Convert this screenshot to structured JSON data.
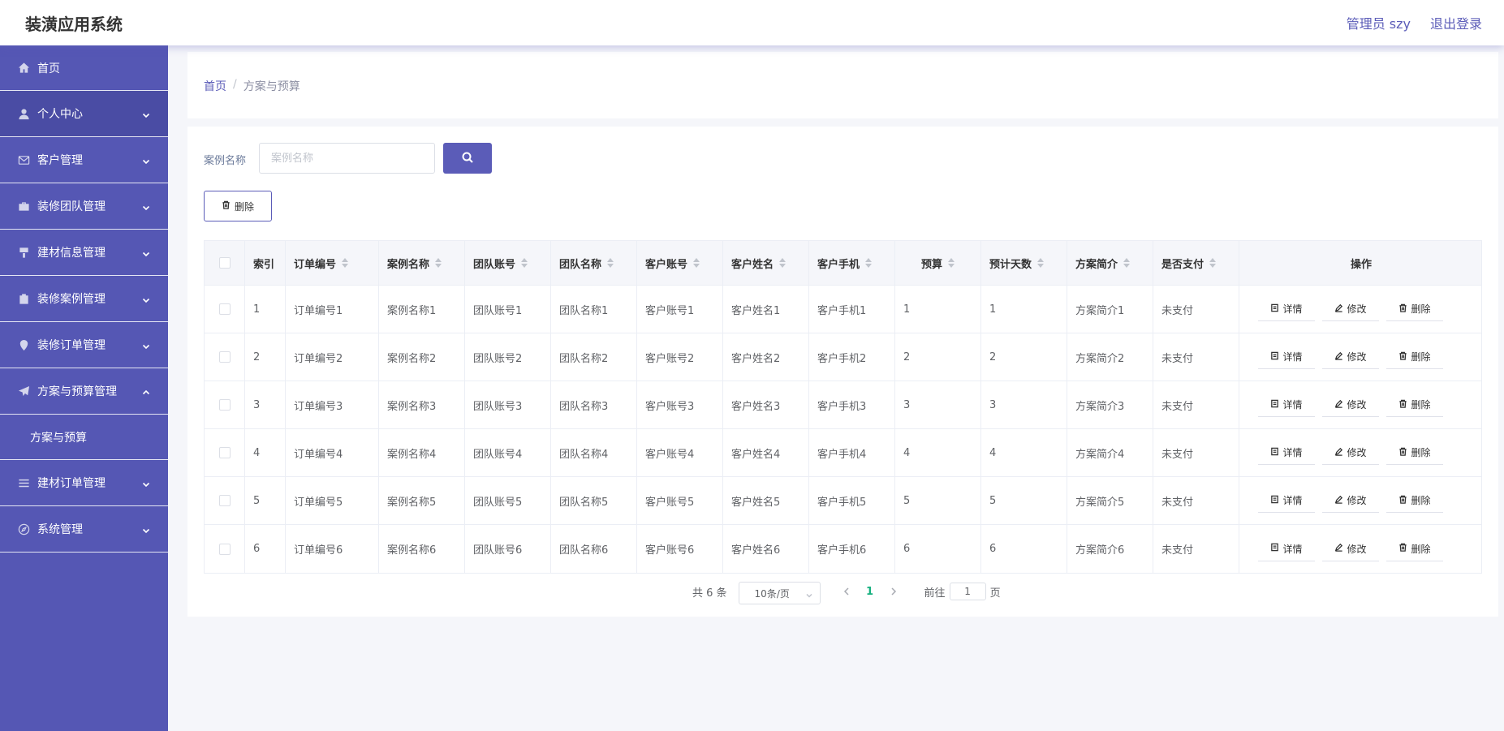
{
  "header": {
    "title": "装潢应用系统",
    "user_label": "管理员 szy",
    "logout_label": "退出登录"
  },
  "sidebar": {
    "items": [
      {
        "label": "首页",
        "icon": "home-icon"
      },
      {
        "label": "个人中心",
        "icon": "user-icon",
        "expandable": true
      },
      {
        "label": "客户管理",
        "icon": "mail-icon",
        "expandable": true
      },
      {
        "label": "装修团队管理",
        "icon": "briefcase-icon",
        "expandable": true
      },
      {
        "label": "建材信息管理",
        "icon": "brush-icon",
        "expandable": true
      },
      {
        "label": "装修案例管理",
        "icon": "clipboard-icon",
        "expandable": true
      },
      {
        "label": "装修订单管理",
        "icon": "location-icon",
        "expandable": true
      },
      {
        "label": "方案与预算管理",
        "icon": "send-icon",
        "expandable": true,
        "expanded": true
      },
      {
        "label": "建材订单管理",
        "icon": "menu-icon",
        "expandable": true
      },
      {
        "label": "系统管理",
        "icon": "compass-icon",
        "expandable": true
      }
    ],
    "submenu": {
      "label": "方案与预算"
    }
  },
  "breadcrumb": {
    "home": "首页",
    "separator": "/",
    "current": "方案与预算"
  },
  "search": {
    "label": "案例名称",
    "placeholder": "案例名称"
  },
  "toolbar": {
    "delete_label": "删除"
  },
  "table": {
    "headers": [
      "索引",
      "订单编号",
      "案例名称",
      "团队账号",
      "团队名称",
      "客户账号",
      "客户姓名",
      "客户手机",
      "预算",
      "预计天数",
      "方案简介",
      "是否支付",
      "操作"
    ],
    "rows": [
      [
        "1",
        "订单编号1",
        "案例名称1",
        "团队账号1",
        "团队名称1",
        "客户账号1",
        "客户姓名1",
        "客户手机1",
        "1",
        "1",
        "方案简介1",
        "未支付"
      ],
      [
        "2",
        "订单编号2",
        "案例名称2",
        "团队账号2",
        "团队名称2",
        "客户账号2",
        "客户姓名2",
        "客户手机2",
        "2",
        "2",
        "方案简介2",
        "未支付"
      ],
      [
        "3",
        "订单编号3",
        "案例名称3",
        "团队账号3",
        "团队名称3",
        "客户账号3",
        "客户姓名3",
        "客户手机3",
        "3",
        "3",
        "方案简介3",
        "未支付"
      ],
      [
        "4",
        "订单编号4",
        "案例名称4",
        "团队账号4",
        "团队名称4",
        "客户账号4",
        "客户姓名4",
        "客户手机4",
        "4",
        "4",
        "方案简介4",
        "未支付"
      ],
      [
        "5",
        "订单编号5",
        "案例名称5",
        "团队账号5",
        "团队名称5",
        "客户账号5",
        "客户姓名5",
        "客户手机5",
        "5",
        "5",
        "方案简介5",
        "未支付"
      ],
      [
        "6",
        "订单编号6",
        "案例名称6",
        "团队账号6",
        "团队名称6",
        "客户账号6",
        "客户姓名6",
        "客户手机6",
        "6",
        "6",
        "方案简介6",
        "未支付"
      ]
    ],
    "actions": {
      "detail": "详情",
      "edit": "修改",
      "delete": "删除"
    }
  },
  "pagination": {
    "total": "共 6 条",
    "page_size": "10条/页",
    "current_page": "1",
    "goto_label": "前往",
    "goto_value": "1",
    "page_suffix": "页"
  },
  "colors": {
    "primary": "#5b5cb8",
    "sidebar": "#5557b4",
    "active_page": "#16b07f"
  }
}
